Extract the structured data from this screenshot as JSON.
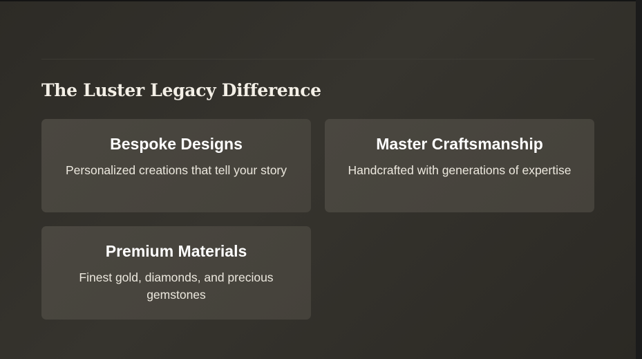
{
  "section": {
    "title": "The Luster Legacy Difference"
  },
  "features": [
    {
      "title": "Bespoke Designs",
      "description": "Personalized creations that tell your story"
    },
    {
      "title": "Master Craftsmanship",
      "description": "Handcrafted with generations of expertise"
    },
    {
      "title": "Premium Materials",
      "description": "Finest gold, diamonds, and precious gemstones"
    }
  ],
  "colors": {
    "background": "#2f2d28",
    "card": "#48453e",
    "title_text": "#f3efe6",
    "body_text": "#ece8de"
  }
}
